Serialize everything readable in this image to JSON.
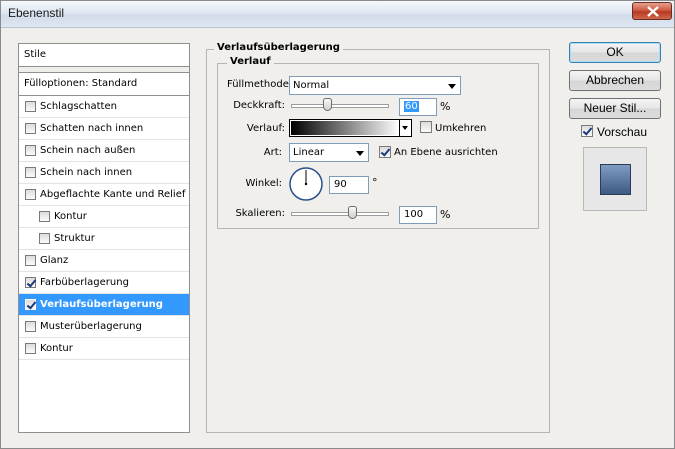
{
  "window": {
    "title": "Ebenenstil"
  },
  "left": {
    "header": "Stile",
    "blend_options": "Fülloptionen: Standard",
    "items": [
      {
        "label": "Schlagschatten",
        "checked": false,
        "sub": false,
        "active": false
      },
      {
        "label": "Schatten nach innen",
        "checked": false,
        "sub": false,
        "active": false
      },
      {
        "label": "Schein nach außen",
        "checked": false,
        "sub": false,
        "active": false
      },
      {
        "label": "Schein nach innen",
        "checked": false,
        "sub": false,
        "active": false
      },
      {
        "label": "Abgeflachte Kante und Relief",
        "checked": false,
        "sub": false,
        "active": false
      },
      {
        "label": "Kontur",
        "checked": false,
        "sub": true,
        "active": false
      },
      {
        "label": "Struktur",
        "checked": false,
        "sub": true,
        "active": false
      },
      {
        "label": "Glanz",
        "checked": false,
        "sub": false,
        "active": false
      },
      {
        "label": "Farbüberlagerung",
        "checked": true,
        "sub": false,
        "active": false
      },
      {
        "label": "Verlaufsüberlagerung",
        "checked": true,
        "sub": false,
        "active": true
      },
      {
        "label": "Musterüberlagerung",
        "checked": false,
        "sub": false,
        "active": false
      },
      {
        "label": "Kontur",
        "checked": false,
        "sub": false,
        "active": false
      }
    ]
  },
  "panel": {
    "title": "Verlaufsüberlagerung",
    "section": "Verlauf",
    "blend_mode_label": "Füllmethode:",
    "blend_mode_value": "Normal",
    "opacity_label": "Deckkraft:",
    "opacity_value": "60",
    "opacity_level": 60,
    "percent": "%",
    "gradient_label": "Verlauf:",
    "reverse_label": "Umkehren",
    "reverse_checked": false,
    "style_label": "Art:",
    "style_value": "Linear",
    "align_label": "An Ebene ausrichten",
    "align_checked": true,
    "angle_label": "Winkel:",
    "angle_value": "90",
    "degree": "°",
    "scale_label": "Skalieren:",
    "scale_value": "100",
    "scale_level": 100
  },
  "buttons": {
    "ok": "OK",
    "cancel": "Abbrechen",
    "new_style": "Neuer Stil...",
    "preview_label": "Vorschau",
    "preview_checked": true
  },
  "colors": {
    "selection": "#3399ff",
    "preview_top": "#7e9cc4",
    "preview_bottom": "#3d5a82"
  }
}
